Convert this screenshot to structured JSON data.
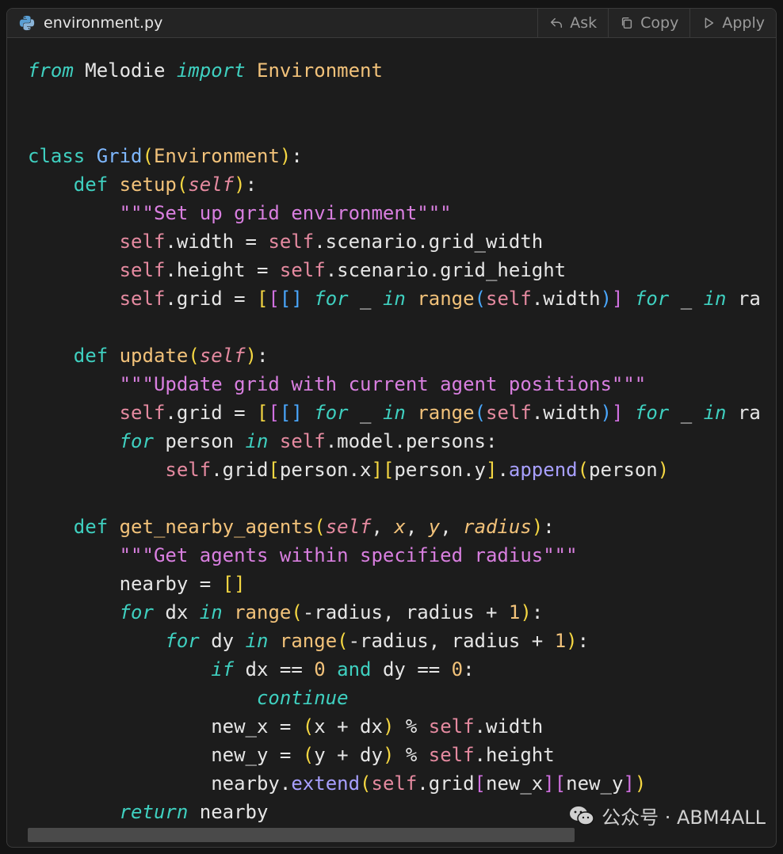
{
  "file": {
    "name": "environment.py",
    "icon": "python-file-icon"
  },
  "actions": [
    {
      "label": "Ask",
      "icon": "reply-arrow-icon"
    },
    {
      "label": "Copy",
      "icon": "copy-icon"
    },
    {
      "label": "Apply",
      "icon": "play-triangle-icon"
    }
  ],
  "code": {
    "language": "python",
    "lines": [
      "from Melodie import Environment",
      "",
      "",
      "class Grid(Environment):",
      "    def setup(self):",
      "        \"\"\"Set up grid environment\"\"\"",
      "        self.width = self.scenario.grid_width",
      "        self.height = self.scenario.grid_height",
      "        self.grid = [[[] for _ in range(self.width)] for _ in ra",
      "",
      "    def update(self):",
      "        \"\"\"Update grid with current agent positions\"\"\"",
      "        self.grid = [[[] for _ in range(self.width)] for _ in ra",
      "        for person in self.model.persons:",
      "            self.grid[person.x][person.y].append(person)",
      "",
      "    def get_nearby_agents(self, x, y, radius):",
      "        \"\"\"Get agents within specified radius\"\"\"",
      "        nearby = []",
      "        for dx in range(-radius, radius + 1):",
      "            for dy in range(-radius, radius + 1):",
      "                if dx == 0 and dy == 0:",
      "                    continue",
      "                new_x = (x + dx) % self.width",
      "                new_y = (y + dy) % self.height",
      "                nearby.extend(self.grid[new_x][new_y])",
      "        return nearby"
    ]
  },
  "watermark": {
    "text": "公众号 · ABM4ALL",
    "icon": "wechat-icon"
  },
  "colors": {
    "background": "#1c1c1c",
    "keyword": "#3fd0c0",
    "function": "#f2c27a",
    "self": "#e58aa0",
    "string": "#d97fe0",
    "class": "#7fb8ff"
  }
}
